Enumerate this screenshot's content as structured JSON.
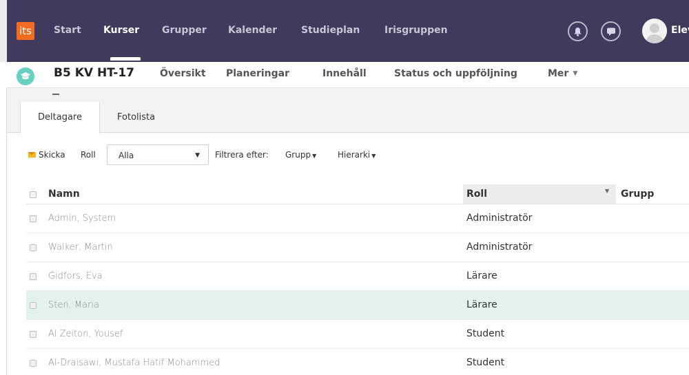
{
  "nav": {
    "logo": "its",
    "items": [
      "Start",
      "Kurser",
      "Grupper",
      "Kalender",
      "Studieplan",
      "Irisgruppen"
    ],
    "active": "Kurser",
    "user_name": "Elev"
  },
  "course": {
    "title": "B5 KV HT-17",
    "links": [
      "Översikt",
      "Planeringar",
      "Innehåll",
      "Status och uppföljning"
    ],
    "more_label": "Mer"
  },
  "tabs": [
    "Deltagare",
    "Fotolista"
  ],
  "active_tab": "Deltagare",
  "filters": {
    "send_label": "Skicka",
    "role_label": "Roll",
    "role_value": "Alla",
    "filter_label": "Filtrera efter:",
    "group_label": "Grupp",
    "hierarchy_label": "Hierarki"
  },
  "table": {
    "headers": {
      "name": "Namn",
      "role": "Roll",
      "group": "Grupp"
    },
    "rows": [
      {
        "name": "Admin, System",
        "role": "Administratör",
        "highlighted": false
      },
      {
        "name": "Walker, Martin",
        "role": "Administratör",
        "highlighted": false
      },
      {
        "name": "Gidfors, Eva",
        "role": "Lärare",
        "highlighted": false
      },
      {
        "name": "Sten, Maria",
        "role": "Lärare",
        "highlighted": true
      },
      {
        "name": "Al Zeiton, Yousef",
        "role": "Student",
        "highlighted": false
      },
      {
        "name": "Al-Draisawi, Mustafa Hatif Mohammed",
        "role": "Student",
        "highlighted": false
      }
    ]
  },
  "colors": {
    "navbar": "#403a5c",
    "logo": "#f26d21",
    "course_icon": "#69cfc1",
    "highlight_row": "#e2f3ef"
  },
  "icons": [
    "bell-icon",
    "chat-icon",
    "user-avatar-icon",
    "graduation-cap-icon",
    "envelope-icon"
  ]
}
